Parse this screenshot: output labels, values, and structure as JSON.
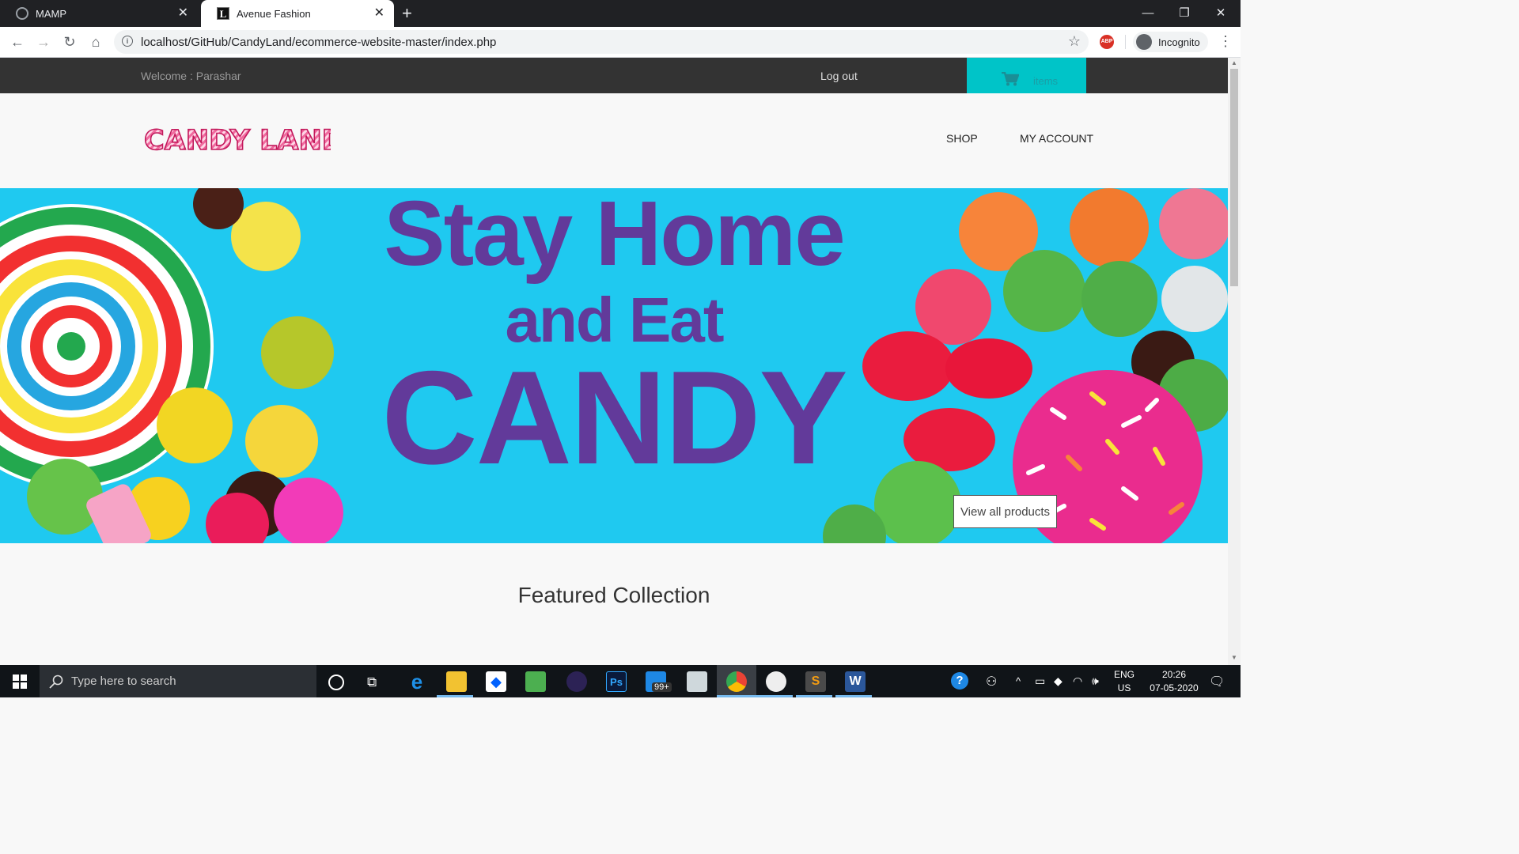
{
  "browser": {
    "tabs": [
      {
        "title": "MAMP",
        "active": false
      },
      {
        "title": "Avenue Fashion",
        "active": true
      }
    ],
    "new_tab": "+",
    "url": "localhost/GitHub/CandyLand/ecommerce-website-master/index.php",
    "incognito_label": "Incognito",
    "adblock_label": "ABP"
  },
  "site": {
    "welcome": "Welcome : Parashar",
    "logout": "Log out",
    "cart_label": "items",
    "logo_text": "CANDY LAND",
    "nav": [
      "SHOP",
      "MY ACCOUNT"
    ],
    "banner": {
      "line1": "Stay Home",
      "line2": "and Eat",
      "line3": "CANDY",
      "button": "View all products"
    },
    "featured_title": "Featured Collection",
    "colors": {
      "hero_text": "#623a9a",
      "banner_bg": "#1fc9f0",
      "cart_bg": "#00c4c8",
      "topbar": "#333333"
    }
  },
  "taskbar": {
    "search_placeholder": "Type here to search",
    "mail_badge": "99+",
    "lang": "ENG",
    "region": "US",
    "time": "20:26",
    "date": "07-05-2020"
  }
}
